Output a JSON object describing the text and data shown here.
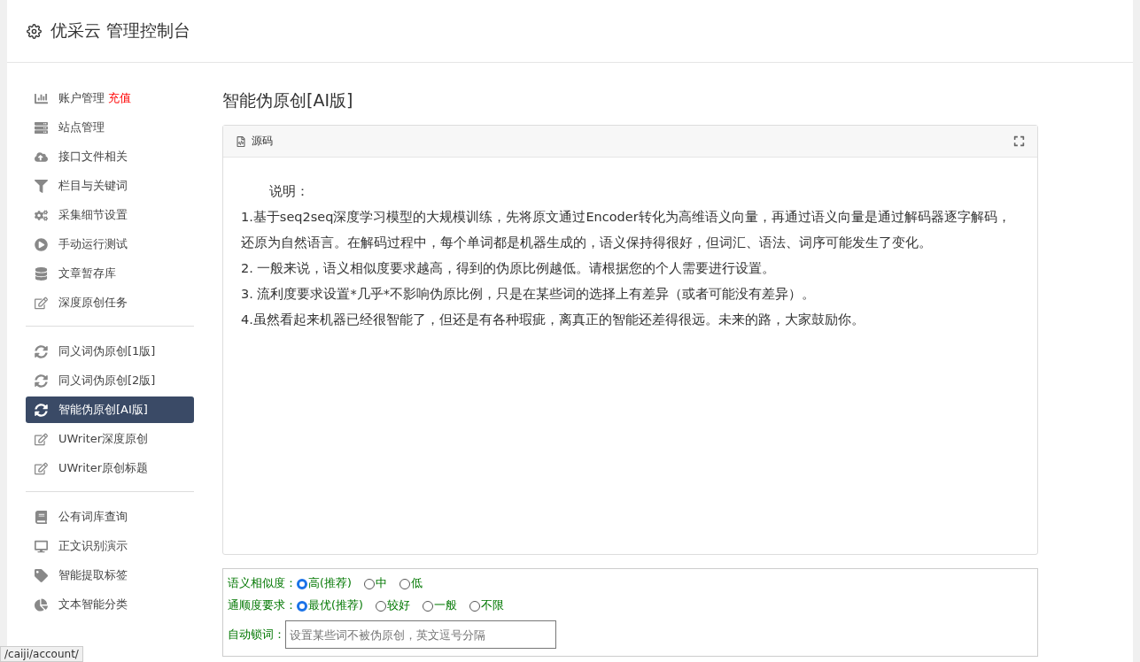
{
  "header": {
    "title": "优采云 管理控制台"
  },
  "sidebar": {
    "groups": [
      {
        "items": [
          {
            "label": "账户管理",
            "badge": "充值",
            "selected": false
          },
          {
            "label": "站点管理",
            "selected": false
          },
          {
            "label": "接口文件相关",
            "selected": false
          },
          {
            "label": "栏目与关键词",
            "selected": false
          },
          {
            "label": "采集细节设置",
            "selected": false
          },
          {
            "label": "手动运行测试",
            "selected": false
          },
          {
            "label": "文章暂存库",
            "selected": false
          },
          {
            "label": "深度原创任务",
            "selected": false
          }
        ]
      },
      {
        "items": [
          {
            "label": "同义词伪原创[1版]",
            "selected": false
          },
          {
            "label": "同义词伪原创[2版]",
            "selected": false
          },
          {
            "label": "智能伪原创[AI版]",
            "selected": true
          },
          {
            "label": "UWriter深度原创",
            "selected": false
          },
          {
            "label": "UWriter原创标题",
            "selected": false
          }
        ]
      },
      {
        "items": [
          {
            "label": "公有词库查询",
            "selected": false
          },
          {
            "label": "正文识别演示",
            "selected": false
          },
          {
            "label": "智能提取标签",
            "selected": false
          },
          {
            "label": "文本智能分类",
            "selected": false
          }
        ]
      }
    ]
  },
  "page_title": "智能伪原创[AI版]",
  "editor": {
    "toolbar_button": "源码",
    "lines": [
      "说明：",
      "1.基于seq2seq深度学习模型的大规模训练，先将原文通过Encoder转化为高维语义向量，再通过语义向量是通过解码器逐字解码，还原为自然语言。在解码过程中，每个单词都是机器生成的，语义保持得很好，但词汇、语法、词序可能发生了变化。",
      "2. 一般来说，语义相似度要求越高，得到的伪原比例越低。请根据您的个人需要进行设置。",
      "3. 流利度要求设置*几乎*不影响伪原比例，只是在某些词的选择上有差异（或者可能没有差异）。",
      "4.虽然看起来机器已经很智能了，但还是有各种瑕疵，离真正的智能还差得很远。未来的路，大家鼓励你。"
    ]
  },
  "form": {
    "radio_groups": [
      {
        "label": "语义相似度：",
        "options": [
          {
            "label": "高(推荐)",
            "selected": true
          },
          {
            "label": "中",
            "selected": false
          },
          {
            "label": "低",
            "selected": false
          }
        ]
      },
      {
        "label": "通顺度要求：",
        "options": [
          {
            "label": "最优(推荐)",
            "selected": true
          },
          {
            "label": "较好",
            "selected": false
          },
          {
            "label": "一般",
            "selected": false
          },
          {
            "label": "不限",
            "selected": false
          }
        ]
      }
    ],
    "lock_words": {
      "label": "自动锁词：",
      "placeholder": "设置某些词不被伪原创，英文逗号分隔"
    }
  },
  "status_bar": {
    "url": "/caiji/account/"
  }
}
